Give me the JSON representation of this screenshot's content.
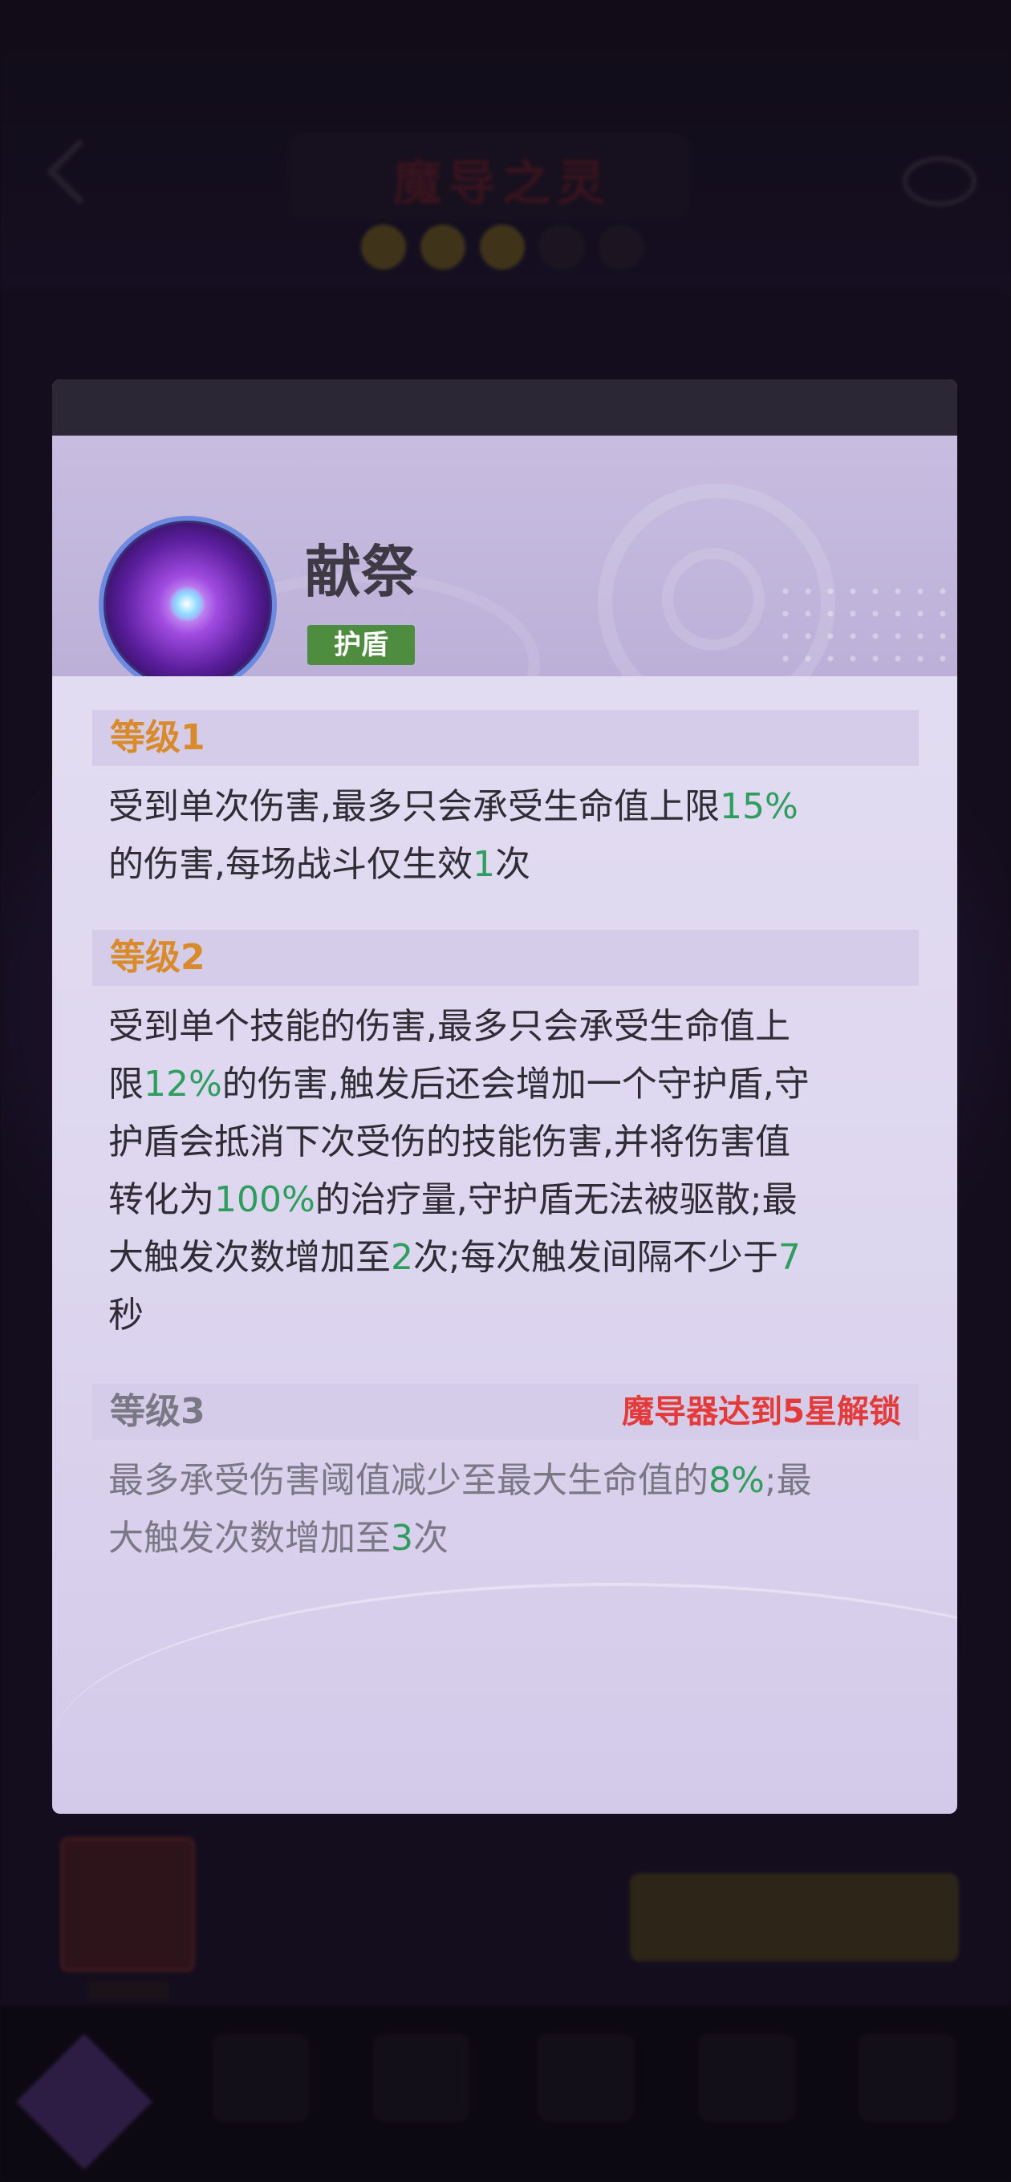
{
  "skill": {
    "name": "献祭",
    "tag": "护盾"
  },
  "levels": [
    {
      "title": "等级1",
      "title_color": "#d98b2b",
      "lock_text": "",
      "locked": false,
      "line1": [
        "受到单次伤害,最多只会承受生命值上限",
        "15%"
      ],
      "line2": [
        "的伤害,每场战斗仅生效",
        "1",
        "次"
      ]
    },
    {
      "title": "等级2",
      "title_color": "#d98b2b",
      "lock_text": "",
      "locked": false,
      "lines": [
        [
          "受到单个技能的伤害,最多只会承受生命值上"
        ],
        [
          "限",
          "12%",
          "的伤害,触发后还会增加一个守护盾,守"
        ],
        [
          "护盾会抵消下次受伤的技能伤害,并将伤害值"
        ],
        [
          "转化为",
          "100%",
          "的治疗量,守护盾无法被驱散;最"
        ],
        [
          "大触发次数增加至",
          "2",
          "次;每次触发间隔不少于",
          "7"
        ],
        [
          "秒"
        ]
      ]
    },
    {
      "title": "等级3",
      "title_color": "#7b7886",
      "lock_text": "魔导器达到5星解锁",
      "locked": true,
      "line1": [
        "最多承受伤害阈值减少至最大生命值的",
        "8%",
        ";最"
      ],
      "line2": [
        "大触发次数增加至",
        "3",
        "次"
      ]
    }
  ],
  "colors": {
    "highlight": "#2e9e5e",
    "tag_bg": "#4e8c3f",
    "lock_text": "#e43a3a",
    "level_title": "#d98b2b"
  },
  "background": {
    "title_text": "魔导之灵"
  }
}
